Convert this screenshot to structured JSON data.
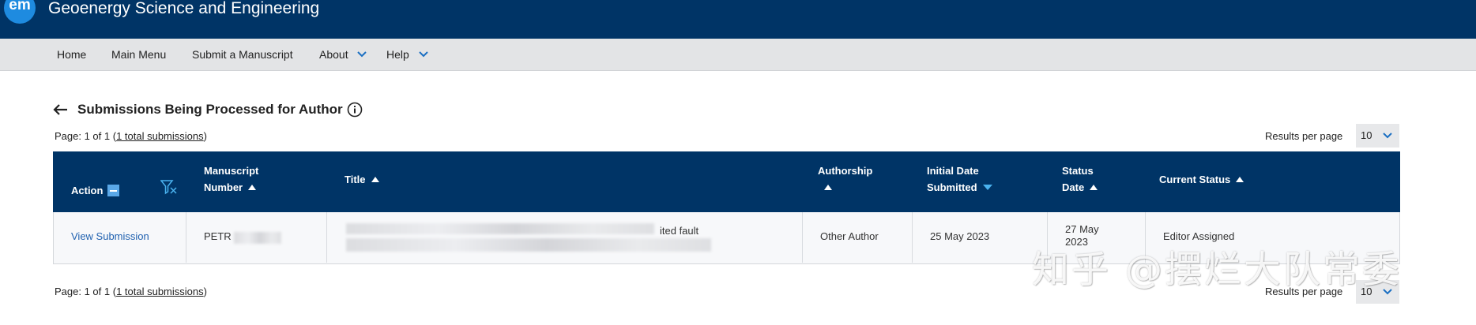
{
  "header": {
    "logo_text": "em",
    "journal_title": "Geoenergy Science and Engineering",
    "background_color": "#003466"
  },
  "nav": {
    "items": [
      {
        "label": "Home",
        "has_dropdown": false
      },
      {
        "label": "Main Menu",
        "has_dropdown": false
      },
      {
        "label": "Submit a Manuscript",
        "has_dropdown": false
      },
      {
        "label": "About",
        "has_dropdown": true
      },
      {
        "label": "Help",
        "has_dropdown": true
      }
    ]
  },
  "page": {
    "title": "Submissions Being Processed for Author",
    "back_icon": "arrow-left-icon",
    "info_icon": "info-icon"
  },
  "pagination_top": {
    "prefix": "Page: 1 of 1 (",
    "link": "1 total submissions",
    "suffix": ")",
    "results_per_page_label": "Results per page",
    "results_per_page_value": "10"
  },
  "pagination_bottom": {
    "prefix": "Page: 1 of 1 (",
    "link": "1 total submissions",
    "suffix": ")",
    "results_per_page_label": "Results per page",
    "results_per_page_value": "10"
  },
  "table": {
    "columns": [
      {
        "line1": "Action",
        "line2": "",
        "sort": "none"
      },
      {
        "line1": "Manuscript",
        "line2": "Number",
        "sort": "asc"
      },
      {
        "line1": "Title",
        "line2": "",
        "sort": "asc"
      },
      {
        "line1": "Authorship",
        "line2": "",
        "sort": "asc"
      },
      {
        "line1": "Initial Date",
        "line2": "Submitted",
        "sort": "desc"
      },
      {
        "line1": "Status",
        "line2": "Date",
        "sort": "asc"
      },
      {
        "line1": "Current Status",
        "line2": "",
        "sort": "asc"
      }
    ],
    "rows": [
      {
        "action": "View Submission",
        "manuscript_number": "PETR",
        "title_visible_fragment": "ited fault",
        "authorship": "Other Author",
        "initial_date_submitted": "25 May 2023",
        "status_date_line1": "27 May",
        "status_date_line2": "2023",
        "current_status": "Editor Assigned"
      }
    ]
  },
  "watermark": "知乎 @摆烂大队常委",
  "colors": {
    "navy": "#003466",
    "link": "#2162b0",
    "sort_active": "#4ab2ef"
  }
}
